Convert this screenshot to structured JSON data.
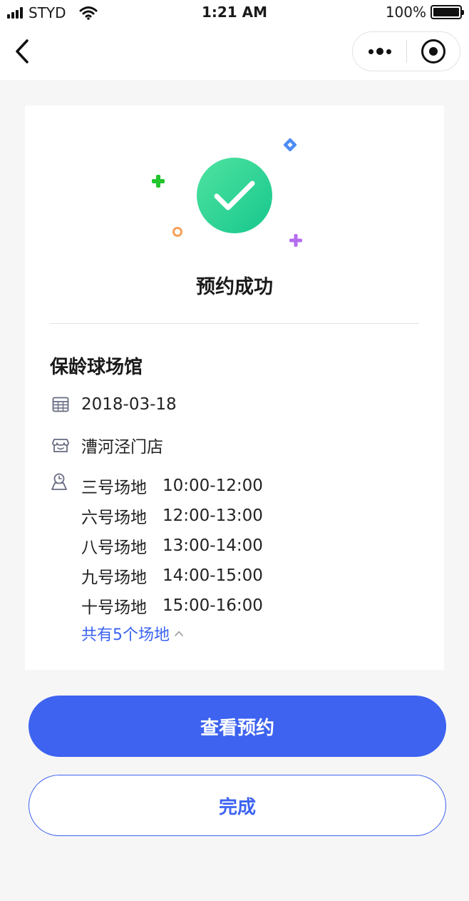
{
  "status_bar": {
    "carrier": "STYD",
    "time": "1:21 AM",
    "battery": "100%"
  },
  "nav": {
    "back_icon": "chevron-left-icon",
    "more_icon": "more-dots-icon",
    "close_icon": "target-circle-icon"
  },
  "success": {
    "title": "预约成功",
    "icon": "check-circle-icon"
  },
  "booking": {
    "venue": "保龄球场馆",
    "date": "2018-03-18",
    "store": "漕河泾门店",
    "courts": [
      {
        "name": "三号场地",
        "time": "10:00-12:00"
      },
      {
        "name": "六号场地",
        "time": "12:00-13:00"
      },
      {
        "name": "八号场地",
        "time": "13:00-14:00"
      },
      {
        "name": "九号场地",
        "time": "14:00-15:00"
      },
      {
        "name": "十号场地",
        "time": "15:00-16:00"
      }
    ],
    "courts_summary": "共有5个场地"
  },
  "actions": {
    "view_label": "查看预约",
    "done_label": "完成"
  },
  "colors": {
    "accent": "#3d63f0",
    "success_start": "#4fe3a0",
    "success_end": "#17c78d",
    "background": "#f6f6f6"
  }
}
